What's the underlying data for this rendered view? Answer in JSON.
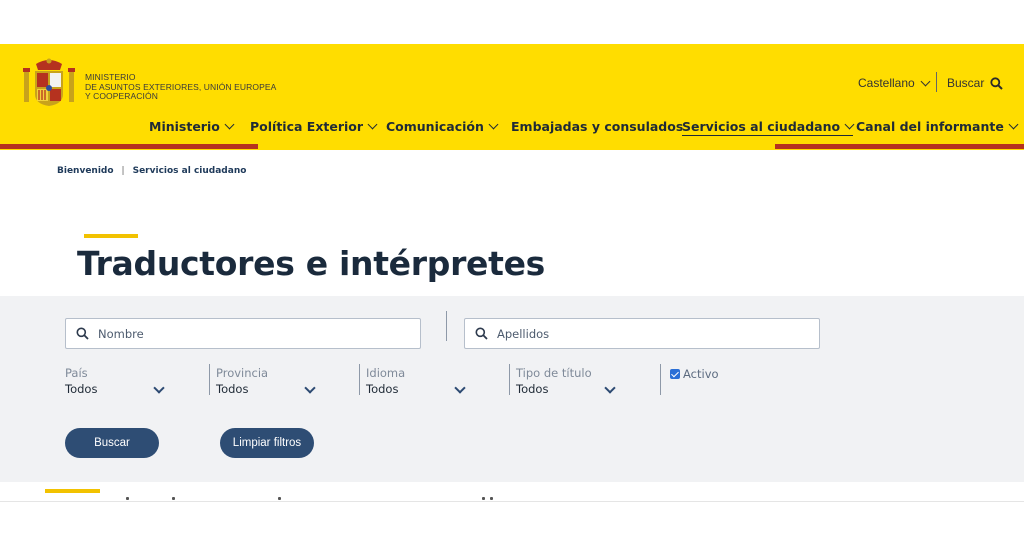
{
  "header": {
    "ministry_lines": [
      "MINISTERIO",
      "DE ASUNTOS EXTERIORES, UNIÓN EUROPEA",
      "Y COOPERACIÓN"
    ],
    "language": "Castellano",
    "search_label": "Buscar",
    "brand_color": "#ffdd00",
    "accent_red": "#b5321f"
  },
  "nav": {
    "items": [
      {
        "label": "Ministerio",
        "has_dropdown": true
      },
      {
        "label": "Política Exterior",
        "has_dropdown": true
      },
      {
        "label": "Comunicación",
        "has_dropdown": true
      },
      {
        "label": "Embajadas y consulados",
        "has_dropdown": false
      },
      {
        "label": "Servicios al ciudadano",
        "has_dropdown": true,
        "active": true
      },
      {
        "label": "Canal del informante",
        "has_dropdown": true
      }
    ]
  },
  "breadcrumb": [
    "Bienvenido",
    "Servicios al ciudadano"
  ],
  "page": {
    "title": "Traductores e intérpretes"
  },
  "filters": {
    "nombre_placeholder": "Nombre",
    "apellidos_placeholder": "Apellidos",
    "selects": [
      {
        "label": "País",
        "value": "Todos"
      },
      {
        "label": "Provincia",
        "value": "Todos"
      },
      {
        "label": "Idioma",
        "value": "Todos"
      },
      {
        "label": "Tipo de título",
        "value": "Todos"
      }
    ],
    "activo_label": "Activo",
    "activo_checked": true,
    "buscar_button": "Buscar",
    "limpiar_button": "Limpiar filtros",
    "button_color": "#2e4d74"
  }
}
